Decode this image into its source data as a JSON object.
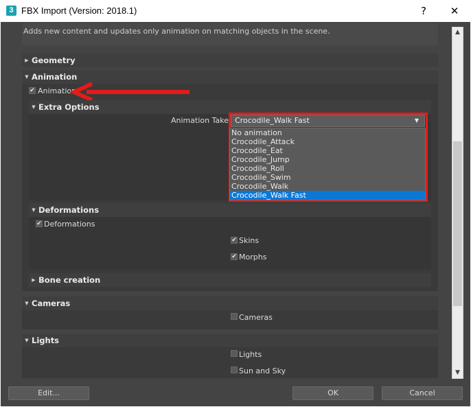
{
  "window": {
    "app_icon_glyph": "3",
    "title": "FBX Import (Version: 2018.1)",
    "help_glyph": "?",
    "close_glyph": "✕"
  },
  "description": "Adds new content and updates only animation on matching objects in the scene.",
  "sections": {
    "geometry": "Geometry",
    "animation": "Animation",
    "cameras": "Cameras",
    "lights": "Lights"
  },
  "animation": {
    "checkbox_label": "Animation",
    "checked": true,
    "extra_options": {
      "title": "Extra Options",
      "take_label": "Animation Take:",
      "take_value": "Crocodile_Walk Fast",
      "options": [
        "No animation",
        "Crocodile_Attack",
        "Crocodile_Eat",
        "Crocodile_Jump",
        "Crocodile_Roll",
        "Crocodile_Swim",
        "Crocodile_Walk",
        "Crocodile_Walk Fast"
      ],
      "selected_index": 7
    },
    "deformations": {
      "title": "Deformations",
      "checkbox_label": "Deformations",
      "skins_label": "Skins",
      "morphs_label": "Morphs"
    },
    "bone_creation": "Bone creation"
  },
  "cameras": {
    "checkbox_label": "Cameras",
    "checked": false
  },
  "lights": {
    "checkbox_label": "Lights",
    "sun_sky_label": "Sun and Sky",
    "checked": false
  },
  "footer": {
    "edit": "Edit...",
    "ok": "OK",
    "cancel": "Cancel"
  },
  "glyphs": {
    "expanded": "▼",
    "collapsed": "▶",
    "check": "✔",
    "dropdown_arrow": "▼",
    "scroll_up": "▲",
    "scroll_down": "▼"
  },
  "colors": {
    "annotation_red": "#e31b1b",
    "selection_blue": "#0a78d7",
    "panel": "#444444",
    "section": "#3a3a3a"
  }
}
